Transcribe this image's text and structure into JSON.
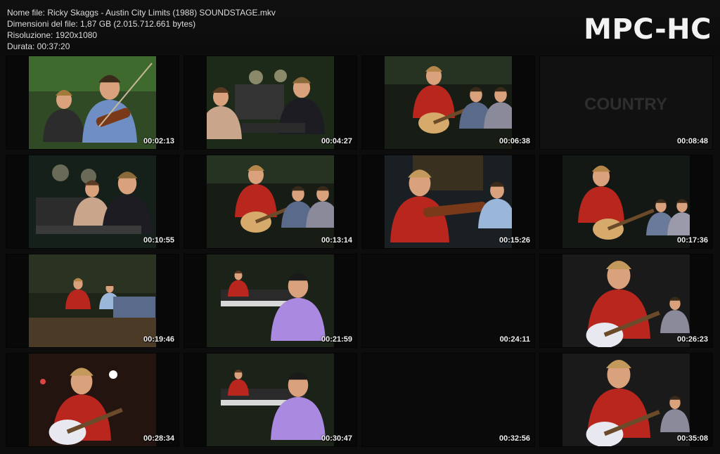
{
  "header": {
    "file_name": "Nome file: Ricky Skaggs - Austin City Limits (1988) SOUNDSTAGE.mkv",
    "file_size": "Dimensioni del file: 1,87 GB (2.015.712.661 bytes)",
    "resolution": "Risoluzione: 1920x1080",
    "duration": "Durata: 00:37:20",
    "logo": "MPC-HC"
  },
  "thumbnails": [
    {
      "time": "00:02:13",
      "scene": "fiddle-closeup"
    },
    {
      "time": "00:04:27",
      "scene": "keyboards-drums"
    },
    {
      "time": "00:06:38",
      "scene": "guitar-singer"
    },
    {
      "time": "00:08:48",
      "scene": "title-card",
      "overlay_text": "COUNTRY"
    },
    {
      "time": "00:10:55",
      "scene": "drummer-keys"
    },
    {
      "time": "00:13:14",
      "scene": "guitar-singer"
    },
    {
      "time": "00:15:26",
      "scene": "fiddle-player"
    },
    {
      "time": "00:17:36",
      "scene": "guitar-band"
    },
    {
      "time": "00:19:46",
      "scene": "wide-stage"
    },
    {
      "time": "00:21:59",
      "scene": "keyboard-player"
    },
    {
      "time": "00:24:11",
      "scene": "black"
    },
    {
      "time": "00:26:23",
      "scene": "guitar-closeup"
    },
    {
      "time": "00:28:34",
      "scene": "guitar-lights"
    },
    {
      "time": "00:30:47",
      "scene": "keyboard-player"
    },
    {
      "time": "00:32:56",
      "scene": "black"
    },
    {
      "time": "00:35:08",
      "scene": "guitar-closeup"
    }
  ]
}
